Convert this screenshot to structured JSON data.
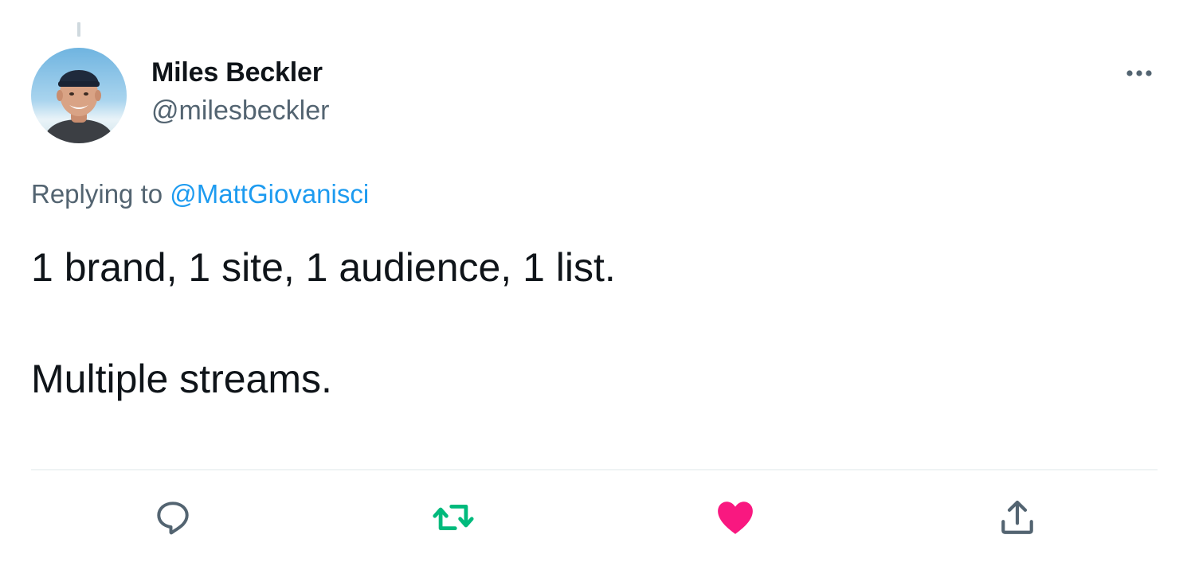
{
  "author": {
    "display_name": "Miles Beckler",
    "handle": "@milesbeckler",
    "avatar": "avatar-photo"
  },
  "reply": {
    "prefix": "Replying to",
    "mention": "@MattGiovanisci"
  },
  "tweet": {
    "lines": [
      "1 brand, 1 site, 1 audience, 1 list.",
      "Multiple streams."
    ]
  },
  "actions": {
    "reply_icon": "comment-icon",
    "retweet_icon": "retweet-icon",
    "like_icon": "heart-icon",
    "share_icon": "share-icon",
    "retweeted": true,
    "liked": true
  },
  "colors": {
    "text_primary": "#0f1419",
    "text_secondary": "#536471",
    "link": "#1d9bf0",
    "retweet_active": "#00ba7c",
    "like_active": "#f91880"
  }
}
